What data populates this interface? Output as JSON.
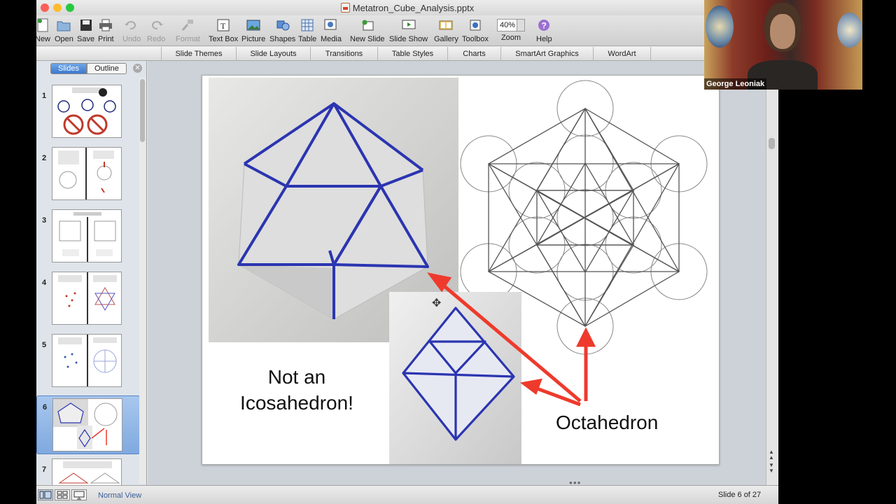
{
  "window": {
    "title": "Metatron_Cube_Analysis.pptx",
    "traffic_colors": [
      "#fc5f57",
      "#fdbc2e",
      "#28c840"
    ]
  },
  "toolbar": {
    "items": [
      {
        "label": "New",
        "icon": "new-doc-icon",
        "enabled": true
      },
      {
        "label": "Open",
        "icon": "open-folder-icon",
        "enabled": true
      },
      {
        "label": "Save",
        "icon": "save-disk-icon",
        "enabled": true
      },
      {
        "label": "Print",
        "icon": "printer-icon",
        "enabled": true
      },
      {
        "label": "Undo",
        "icon": "undo-icon",
        "enabled": false
      },
      {
        "label": "Redo",
        "icon": "redo-icon",
        "enabled": false
      },
      {
        "label": "Format",
        "icon": "format-brush-icon",
        "enabled": false
      },
      {
        "label": "Text Box",
        "icon": "text-box-icon",
        "enabled": true
      },
      {
        "label": "Picture",
        "icon": "picture-icon",
        "enabled": true
      },
      {
        "label": "Shapes",
        "icon": "shapes-icon",
        "enabled": true
      },
      {
        "label": "Table",
        "icon": "table-icon",
        "enabled": true
      },
      {
        "label": "Media",
        "icon": "media-icon",
        "enabled": true
      },
      {
        "label": "New Slide",
        "icon": "new-slide-icon",
        "enabled": true
      },
      {
        "label": "Slide Show",
        "icon": "slide-show-icon",
        "enabled": true
      },
      {
        "label": "Gallery",
        "icon": "gallery-icon",
        "enabled": true
      },
      {
        "label": "Toolbox",
        "icon": "toolbox-icon",
        "enabled": true
      },
      {
        "label": "Zoom",
        "icon": "zoom-select",
        "enabled": true
      },
      {
        "label": "Help",
        "icon": "help-icon",
        "enabled": true
      }
    ],
    "zoom_value": "40%"
  },
  "ribbon": {
    "tabs": [
      "Slide Themes",
      "Slide Layouts",
      "Transitions",
      "Table Styles",
      "Charts",
      "SmartArt Graphics",
      "WordArt"
    ]
  },
  "left_pane": {
    "tabs": [
      "Slides",
      "Outline"
    ],
    "active_tab": "Slides",
    "slides": [
      {
        "number": "1",
        "selected": false
      },
      {
        "number": "2",
        "selected": false
      },
      {
        "number": "3",
        "selected": false
      },
      {
        "number": "4",
        "selected": false
      },
      {
        "number": "5",
        "selected": false
      },
      {
        "number": "6",
        "selected": true
      },
      {
        "number": "7",
        "selected": false
      }
    ]
  },
  "slide": {
    "left_caption_line1": "Not an",
    "left_caption_line2": "Icosahedron!",
    "right_caption": "Octahedron",
    "arrow_color": "#ee3a2c",
    "pen_color": "#2b35b0"
  },
  "status_bar": {
    "view_label": "Normal View",
    "slide_counter": "Slide 6 of 27"
  },
  "webcam": {
    "name": "George Leoniak"
  }
}
